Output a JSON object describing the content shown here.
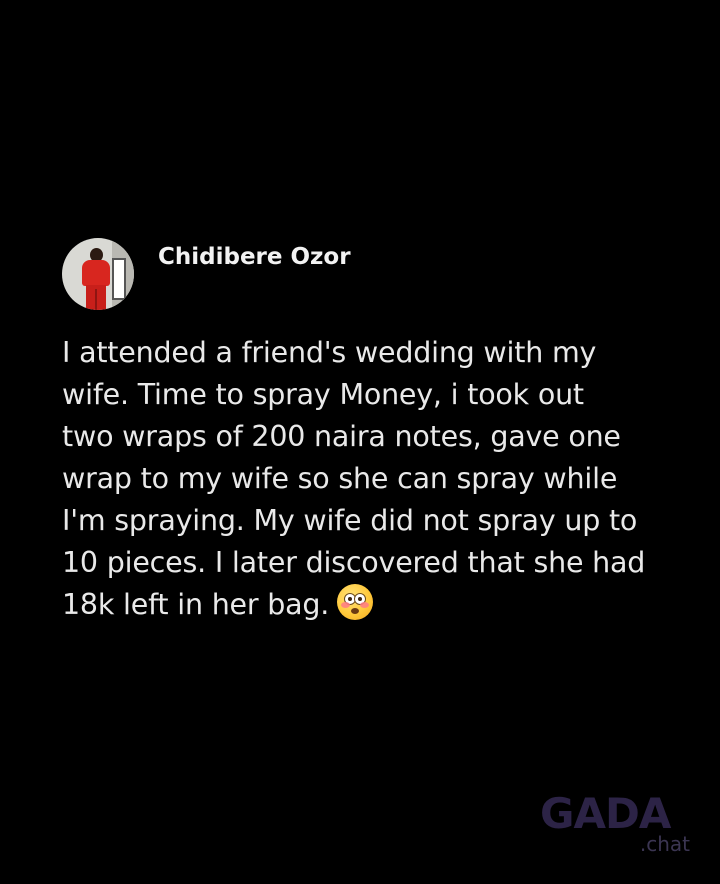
{
  "post": {
    "author_name": "Chidibere Ozor",
    "body_lines": [
      "I attended a friend's wedding with my",
      "wife. Time to spray Money, i took out",
      "two wraps of 200 naira notes, gave one",
      "wrap to my wife so she can spray while",
      "I'm spraying. My wife did not spray up to",
      "10 pieces. I later discovered that she had",
      "18k left in her bag."
    ],
    "emoji_icon": "flushed-face-icon"
  },
  "watermark": {
    "logo": "GADA",
    "sub": ".chat"
  },
  "colors": {
    "background": "#000000",
    "text": "#e9e9e9",
    "watermark": "#2c2346"
  }
}
